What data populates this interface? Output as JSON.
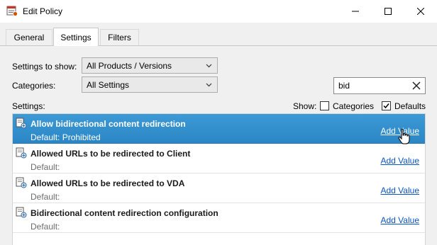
{
  "window": {
    "title": "Edit Policy",
    "app_icon": "policy-icon",
    "controls": [
      "minimize-icon",
      "maximize-icon",
      "close-icon"
    ]
  },
  "tabs": [
    {
      "label": "General",
      "active": false
    },
    {
      "label": "Settings",
      "active": true
    },
    {
      "label": "Filters",
      "active": false
    }
  ],
  "filters": {
    "settings_to_show_label": "Settings to show:",
    "settings_to_show_value": "All Products / Versions",
    "categories_label": "Categories:",
    "categories_value": "All Settings",
    "search_value": "bid"
  },
  "settings_header": {
    "label": "Settings:",
    "show_label": "Show:",
    "categories_checkbox_label": "Categories",
    "categories_checked": false,
    "defaults_checkbox_label": "Defaults",
    "defaults_checked": true
  },
  "settings": [
    {
      "name": "Allow bidirectional content redirection",
      "default": "Default: Prohibited",
      "action": "Add Value",
      "selected": true
    },
    {
      "name": "Allowed URLs to be redirected to Client",
      "default": "Default:",
      "action": "Add Value",
      "selected": false
    },
    {
      "name": "Allowed URLs to be redirected to VDA",
      "default": "Default:",
      "action": "Add Value",
      "selected": false
    },
    {
      "name": "Bidirectional content redirection configuration",
      "default": "Default:",
      "action": "Add Value",
      "selected": false
    }
  ],
  "colors": {
    "selection": "#2f8ccb",
    "link": "#0b55c4",
    "panel_bg": "#f0f0f0"
  }
}
